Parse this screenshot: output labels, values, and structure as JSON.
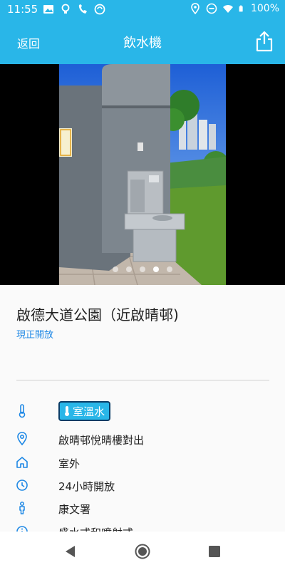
{
  "status_bar": {
    "time": "11:55",
    "battery": "100%",
    "left_icons": [
      "image-icon",
      "bulb-icon",
      "wifi-calling-icon",
      "vpn-icon"
    ],
    "right_icons": [
      "location-icon",
      "dnd-icon",
      "wifi-icon",
      "battery-icon"
    ]
  },
  "app_bar": {
    "back_label": "返回",
    "title": "飲水機",
    "share_icon": "share-icon",
    "color": "#29b6e8"
  },
  "carousel": {
    "photo_count": 5,
    "active_index": 3
  },
  "place": {
    "name": "啟德大道公園（近啟晴邨)",
    "status": "現正開放",
    "status_color": "#1e88e5"
  },
  "details": {
    "water_type": "室溫水",
    "location": "啟晴邨悅晴樓對出",
    "setting": "室外",
    "hours": "24小時開放",
    "department": "康文署",
    "dispenser_type": "盛水式和噴射式"
  }
}
